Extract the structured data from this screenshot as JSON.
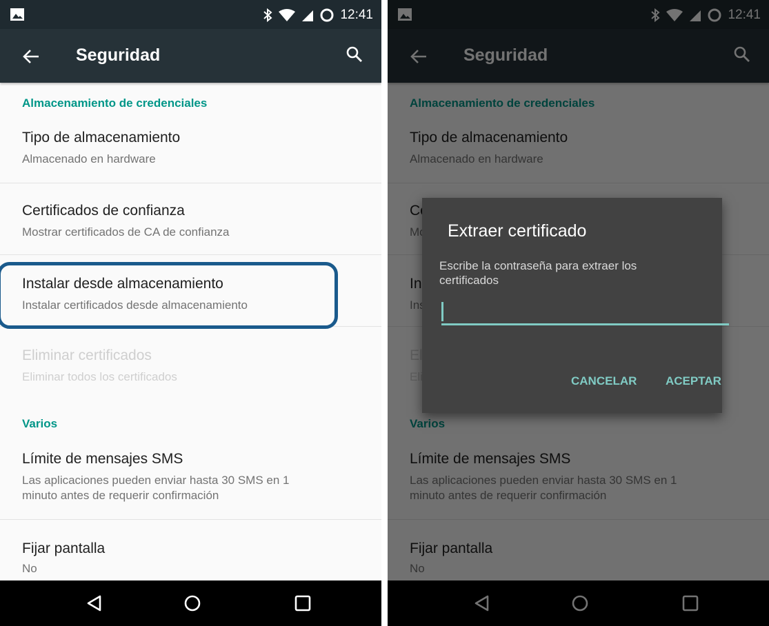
{
  "status_bar": {
    "time": "12:41"
  },
  "app_bar": {
    "title": "Seguridad"
  },
  "sections": {
    "credentials_header": "Almacenamiento de credenciales",
    "misc_header": "Varios"
  },
  "items": {
    "storage_type": {
      "title": "Tipo de almacenamiento",
      "subtitle": "Almacenado en hardware"
    },
    "trusted_certs": {
      "title": "Certificados de confianza",
      "subtitle": "Mostrar certificados de CA de confianza"
    },
    "install_storage": {
      "title": "Instalar desde almacenamiento",
      "subtitle": "Instalar certificados desde almacenamiento"
    },
    "clear_certs": {
      "title": "Eliminar certificados",
      "subtitle": "Eliminar todos los certificados"
    },
    "sms_limit": {
      "title": "Límite de mensajes SMS",
      "subtitle_line1": "Las aplicaciones pueden enviar hasta 30 SMS en 1",
      "subtitle_line2": "minuto antes de requerir confirmación"
    },
    "screen_pin": {
      "title": "Fijar pantalla",
      "subtitle": "No"
    }
  },
  "dialog": {
    "title": "Extraer certificado",
    "message": "Escribe la contraseña para extraer los certificados",
    "input_value": "",
    "cancel_label": "CANCELAR",
    "accept_label": "ACEPTAR"
  },
  "colors": {
    "accent": "#009688",
    "dialog_accent": "#80cbc4",
    "app_bar": "#263238",
    "highlight": "#1a5a8c"
  },
  "icons": [
    "image-icon",
    "bluetooth-icon",
    "wifi-icon",
    "signal-icon",
    "battery-icon",
    "back-arrow-icon",
    "search-icon",
    "nav-back-icon",
    "nav-home-icon",
    "nav-recents-icon"
  ]
}
